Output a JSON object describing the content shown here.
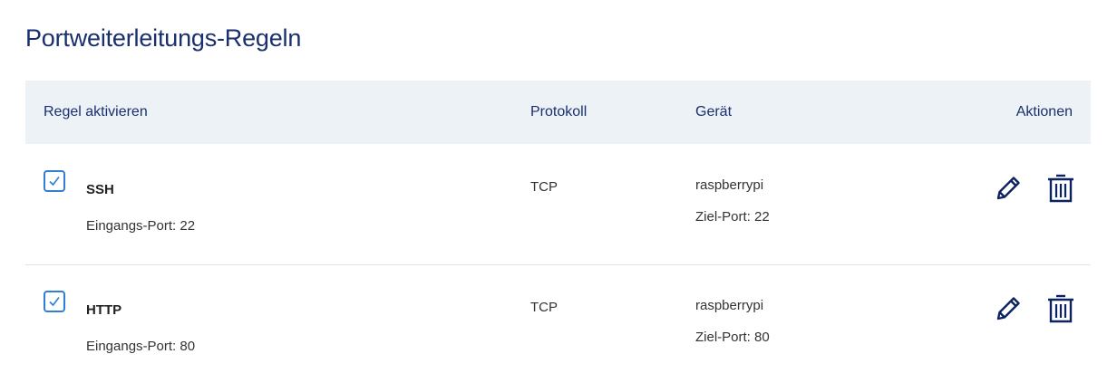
{
  "page": {
    "title": "Portweiterleitungs-Regeln"
  },
  "table": {
    "headers": {
      "enable": "Regel aktivieren",
      "protocol": "Protokoll",
      "device": "Gerät",
      "actions": "Aktionen"
    },
    "rows": [
      {
        "enabled": true,
        "name": "SSH",
        "ingress_port": "Eingangs-Port: 22",
        "protocol": "TCP",
        "device": "raspberrypi",
        "target_port": "Ziel-Port: 22"
      },
      {
        "enabled": true,
        "name": "HTTP",
        "ingress_port": "Eingangs-Port: 80",
        "protocol": "TCP",
        "device": "raspberrypi",
        "target_port": "Ziel-Port: 80"
      }
    ]
  },
  "icons": {
    "edit": "pencil-icon",
    "delete": "trash-icon",
    "checkbox": "checkmark-icon"
  },
  "colors": {
    "title": "#1a2f6e",
    "header_bg": "#edf2f7",
    "checkbox": "#2f7fd8",
    "icon": "#0d2260"
  }
}
